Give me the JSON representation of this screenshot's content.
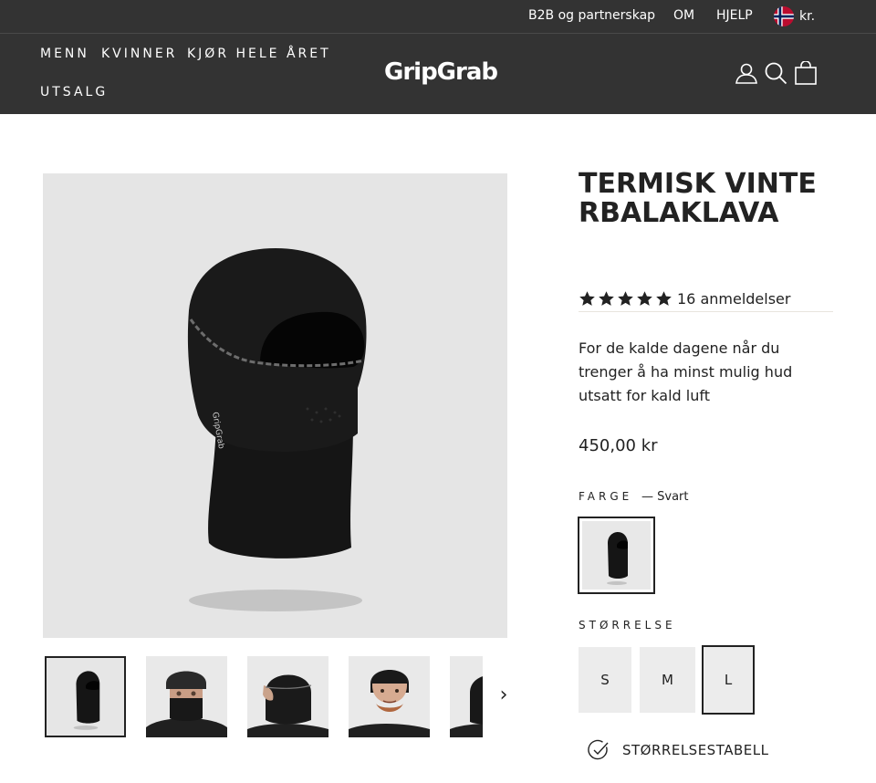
{
  "utility": {
    "b2b_label": "B2B og partnerskap",
    "om_label": "OM",
    "help_label": "HJELP",
    "currency_label": "kr.",
    "flag_icon": "norway-flag-icon"
  },
  "nav": {
    "menn": "MENN",
    "kvinner": "KVINNER",
    "hele_aret": "KJØR HELE ÅRET",
    "utsalg": "UTSALG"
  },
  "brand": {
    "logo_text": "GripGrab"
  },
  "header_icons": [
    "account-icon",
    "search-icon",
    "cart-icon"
  ],
  "product": {
    "title": "TERMISK VINTERBALAKLAVA",
    "rating_stars": 5,
    "review_count": "16 anmeldelser",
    "description": "For de kalde dagene når du trenger å ha minst mulig hud utsatt for kald luft",
    "price": "450,00 kr",
    "color_label": "FARGE",
    "color_value": "— Svart",
    "size_label": "STØRRELSE",
    "sizes": [
      "S",
      "M",
      "L"
    ],
    "selected_size": "L",
    "size_chart_label": "STØRRELSESTABELL"
  },
  "gallery": {
    "thumbnail_count_visible": 5,
    "next_icon": "chevron-right-icon",
    "next_glyph": "›"
  },
  "colors": {
    "header_bg": "#333333",
    "page_bg": "#ffffff",
    "text": "#222222",
    "star": "#222222",
    "size_btn_bg": "#ececec"
  }
}
